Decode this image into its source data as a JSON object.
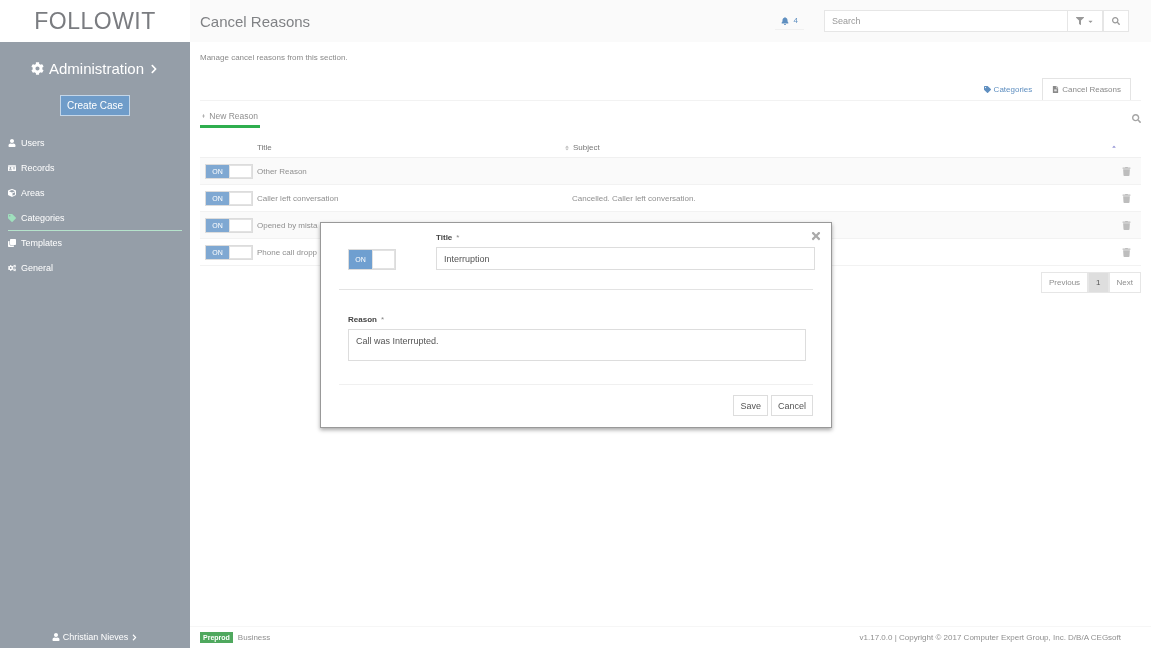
{
  "logo": "FOLLOWIT",
  "sidebar": {
    "heading": "Administration",
    "create_button": "Create Case",
    "items": [
      {
        "label": "Users",
        "selected": false
      },
      {
        "label": "Records",
        "selected": false
      },
      {
        "label": "Areas",
        "selected": false
      },
      {
        "label": "Categories",
        "selected": true
      },
      {
        "label": "Templates",
        "selected": false
      },
      {
        "label": "General",
        "selected": false
      }
    ],
    "user": "Christian Nieves"
  },
  "header": {
    "title": "Cancel Reasons",
    "notifications": "4",
    "search": {
      "placeholder": "Search"
    }
  },
  "description": "Manage cancel reasons from this section.",
  "tabs": [
    {
      "label": "Categories",
      "selected": false
    },
    {
      "label": "Cancel Reasons",
      "selected": true
    }
  ],
  "new_button": "New Reason",
  "table": {
    "columns": [
      "Title",
      "Subject"
    ],
    "rows": [
      {
        "on": true,
        "toggle_label": "ON",
        "title": "Other Reason"
      },
      {
        "on": true,
        "toggle_label": "ON",
        "title": "Caller left conversation",
        "subject": "Cancelled. Caller left conversation."
      },
      {
        "on": true,
        "toggle_label": "ON",
        "title": "Opened by mista"
      },
      {
        "on": true,
        "toggle_label": "ON",
        "title": "Phone call dropp"
      }
    ]
  },
  "pagination": [
    {
      "label": "Previous",
      "selected": false
    },
    {
      "label": "1",
      "selected": true
    },
    {
      "label": "Next",
      "selected": false
    }
  ],
  "footer": {
    "badge": "Preprod",
    "environment": "Business",
    "copyright": "v1.17.0.0 | Copyright © 2017 Computer Expert Group, Inc. D/B/A CEGsoft"
  },
  "modal": {
    "toggle": {
      "on": true,
      "label": "ON"
    },
    "title_label": "Title",
    "required_mark": "*",
    "title_value": "Interruption",
    "reason_label": "Reason",
    "reason_required_mark": "*",
    "reason_value": "Call was Interrupted.",
    "buttons": [
      "Save",
      "Cancel"
    ]
  }
}
